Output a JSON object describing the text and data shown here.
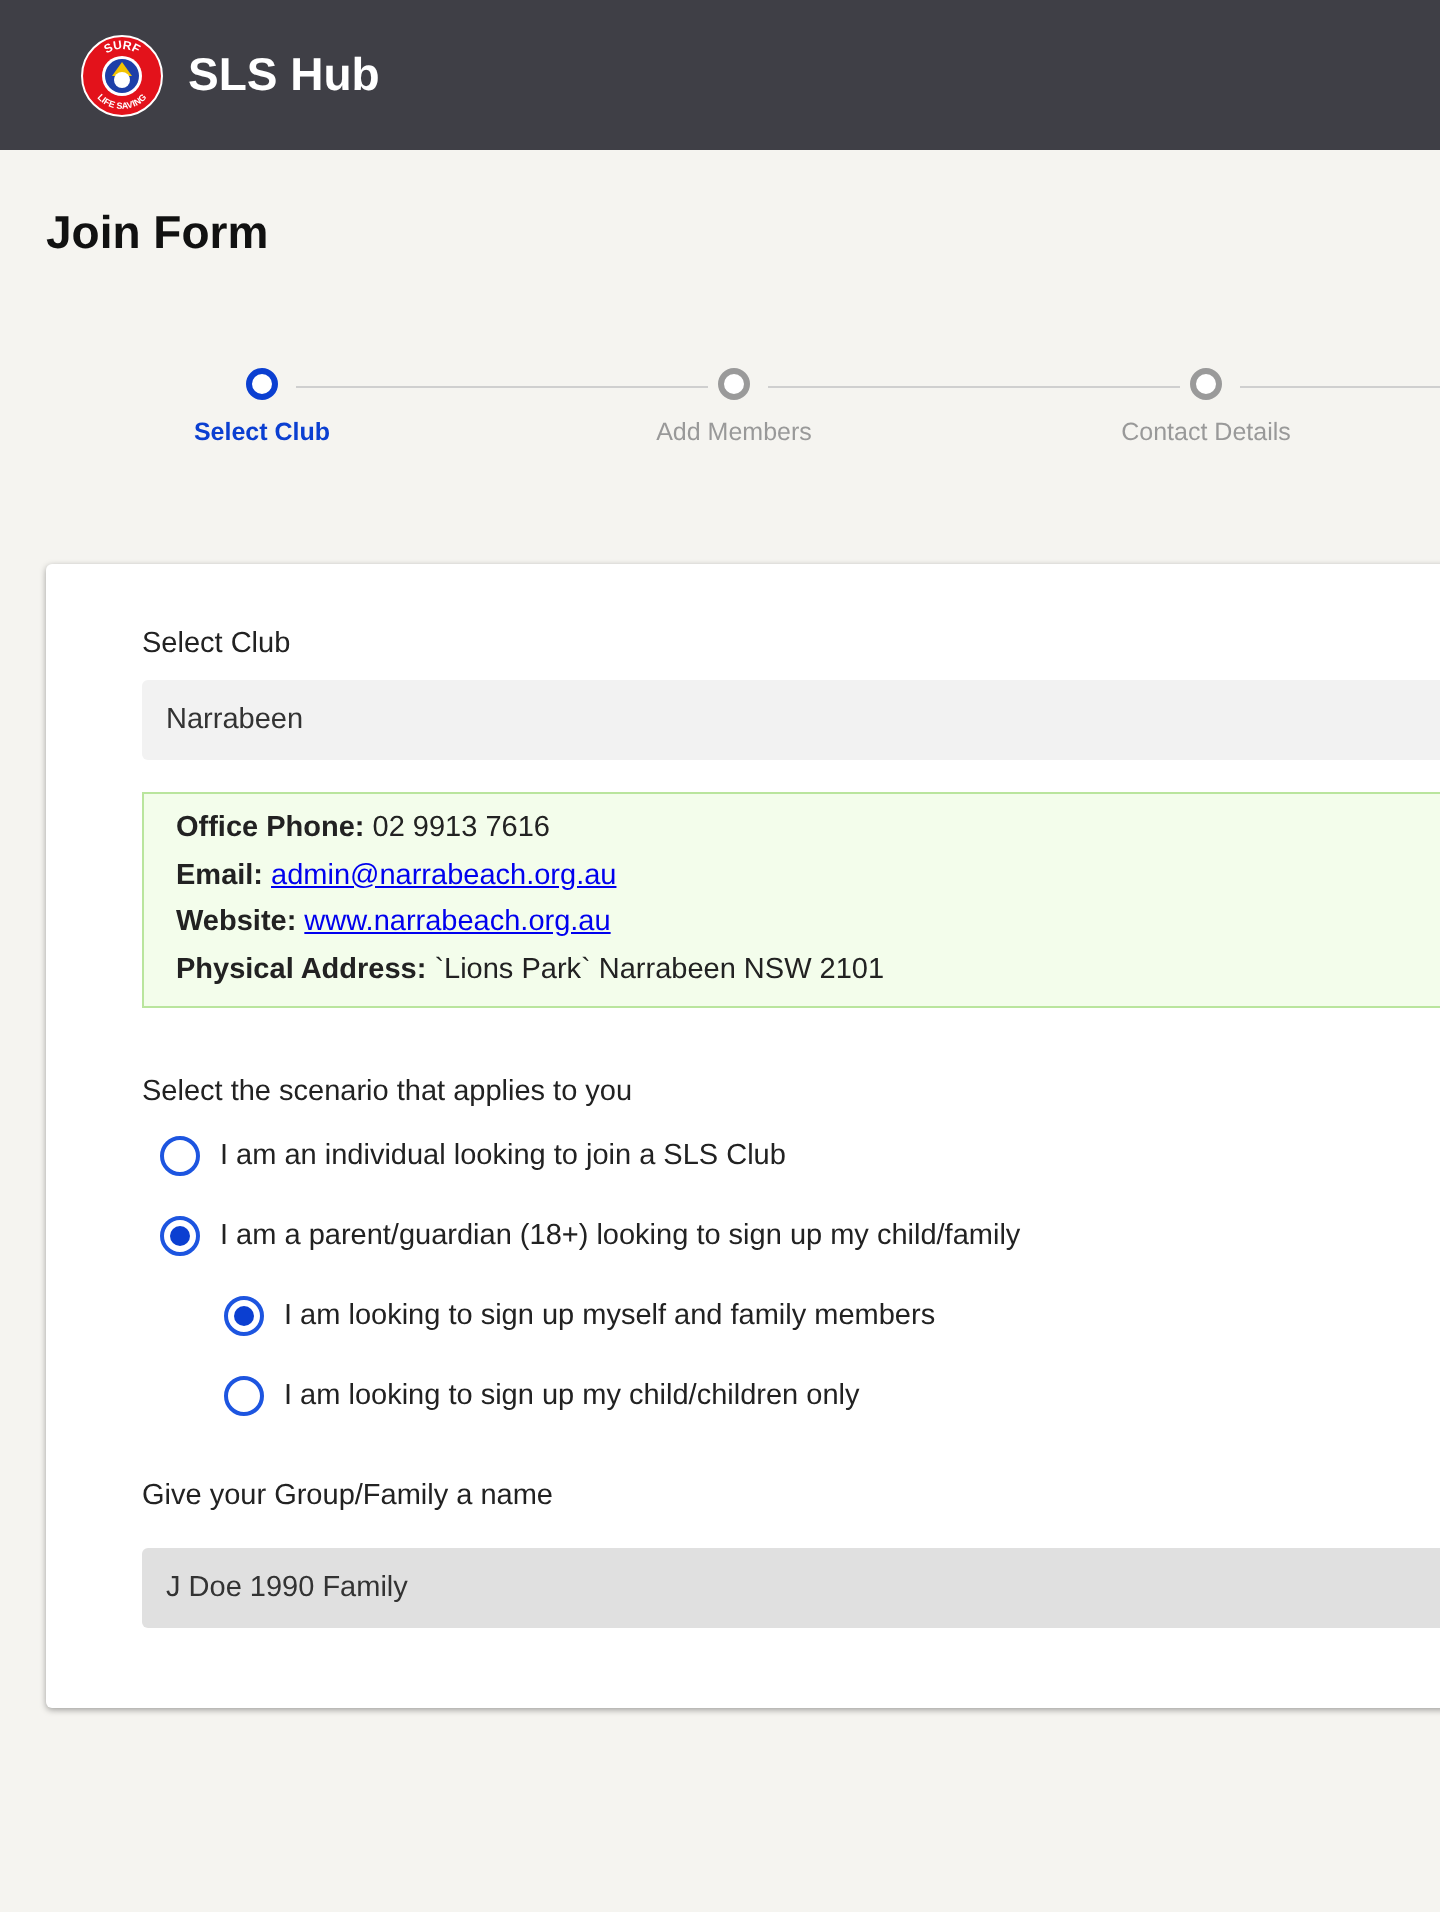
{
  "header": {
    "logo": {
      "top_text": "SURF",
      "bottom_text": "LIFE SAVING"
    },
    "title": "SLS Hub"
  },
  "page_title": "Join Form",
  "steps": [
    {
      "label": "Select Club",
      "selected": true
    },
    {
      "label": "Add Members",
      "selected": false
    },
    {
      "label": "Contact Details",
      "selected": false
    }
  ],
  "club_field": {
    "label": "Select Club",
    "value": "Narrabeen"
  },
  "club_info": [
    {
      "label": "Office Phone:",
      "value": "02 9913 7616",
      "kind": "text"
    },
    {
      "label": "Email:",
      "value": "admin@narrabeach.org.au",
      "kind": "link"
    },
    {
      "label": "Website:",
      "value": "www.narrabeach.org.au",
      "kind": "link"
    },
    {
      "label": "Physical Address:",
      "value": "`Lions Park` Narrabeen NSW 2101",
      "kind": "text"
    }
  ],
  "scenario": {
    "label": "Select the scenario that applies to you",
    "options": [
      {
        "label": "I am an individual looking to join a SLS Club",
        "selected": false
      },
      {
        "label": "I am a parent/guardian (18+) looking to sign up my child/family",
        "selected": true,
        "children": [
          {
            "label": "I am looking to sign up myself and family members",
            "selected": true
          },
          {
            "label": "I am looking to sign up my child/children only",
            "selected": false
          }
        ]
      }
    ]
  },
  "group_field": {
    "label": "Give your Group/Family a name",
    "value": "J Doe 1990 Family"
  }
}
